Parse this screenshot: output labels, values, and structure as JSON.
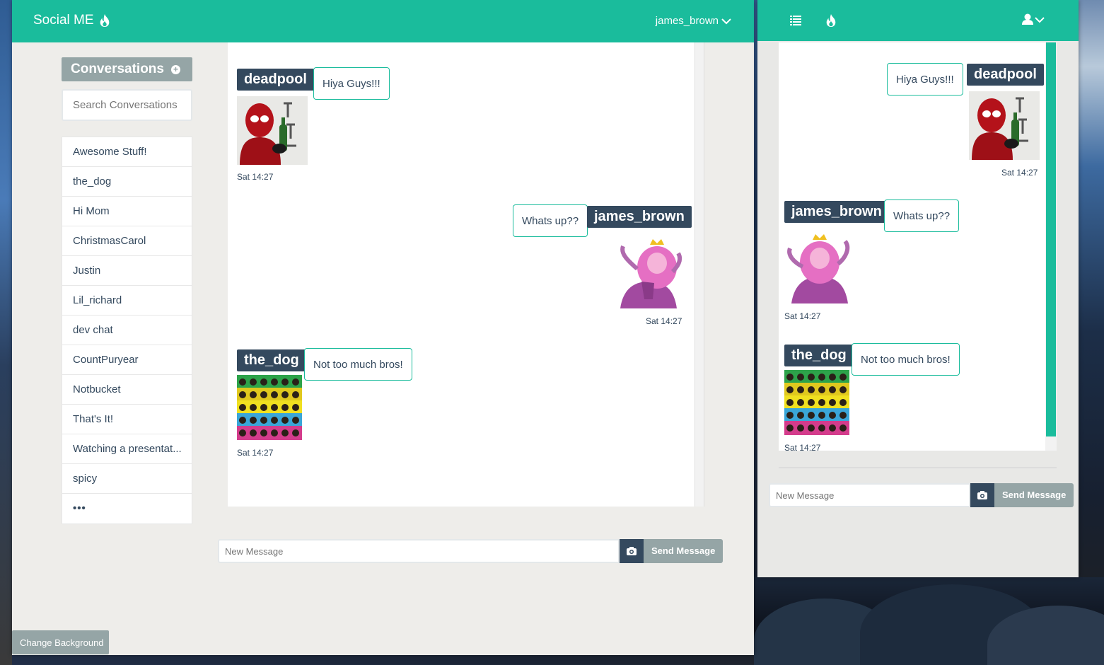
{
  "app": {
    "brand": "Social ME",
    "username": "james_brown"
  },
  "conversations": {
    "header": "Conversations",
    "search_placeholder": "Search Conversations",
    "items": [
      "Awesome Stuff!",
      "the_dog",
      "Hi Mom",
      "ChristmasCarol",
      "Justin",
      "Lil_richard",
      "dev chat",
      "CountPuryear",
      "Notbucket",
      "That's It!",
      "Watching a presentat...",
      "spicy",
      "•••"
    ]
  },
  "messages": [
    {
      "user": "deadpool",
      "text": "Hiya Guys!!!",
      "time": "Sat 14:27",
      "avatar": "deadpool-avatar"
    },
    {
      "user": "james_brown",
      "text": "Whats up??",
      "time": "Sat 14:27",
      "avatar": "princess-bubblegum-avatar"
    },
    {
      "user": "the_dog",
      "text": "Not too much bros!",
      "time": "Sat 14:27",
      "avatar": "album-collage-avatar"
    }
  ],
  "composer": {
    "placeholder": "New Message",
    "send_label": "Send Message"
  },
  "footer": {
    "change_background": "Change Background"
  },
  "colors": {
    "accent": "#1abc9c",
    "dark": "#34495e",
    "muted": "#95a5a6"
  }
}
